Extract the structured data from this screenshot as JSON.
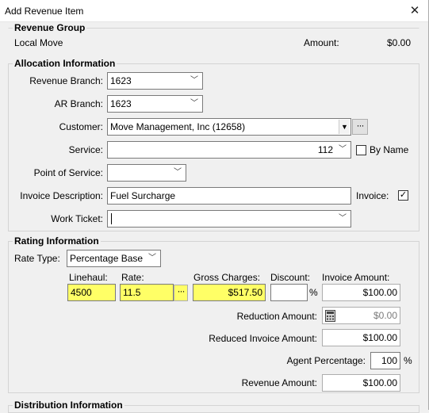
{
  "window": {
    "title": "Add Revenue Item"
  },
  "revenue_group": {
    "title": "Revenue Group",
    "value": "Local Move",
    "amount_label": "Amount:",
    "amount_value": "$0.00"
  },
  "allocation": {
    "title": "Allocation Information",
    "revenue_branch": {
      "label": "Revenue Branch:",
      "value": "1623"
    },
    "ar_branch": {
      "label": "AR Branch:",
      "value": "1623"
    },
    "customer": {
      "label": "Customer:",
      "value": "Move Management, Inc (12658)",
      "more": "···"
    },
    "service": {
      "label": "Service:",
      "value": "112",
      "by_name_label": "By Name",
      "by_name_checked": false
    },
    "point_of_service": {
      "label": "Point of Service:",
      "value": ""
    },
    "invoice_description": {
      "label": "Invoice Description:",
      "value": "Fuel Surcharge"
    },
    "invoice": {
      "label": "Invoice:",
      "checked": true,
      "check_glyph": "✓"
    },
    "work_ticket": {
      "label": "Work Ticket:",
      "value": ""
    }
  },
  "rating": {
    "title": "Rating Information",
    "rate_type": {
      "label": "Rate Type:",
      "value": "Percentage Base"
    },
    "linehaul": {
      "label": "Linehaul:",
      "value": "4500"
    },
    "rate": {
      "label": "Rate:",
      "value": "11.5",
      "more": "···"
    },
    "gross_charges": {
      "label": "Gross Charges:",
      "value": "$517.50"
    },
    "discount": {
      "label": "Discount:",
      "value": "",
      "unit": "%"
    },
    "invoice_amount": {
      "label": "Invoice Amount:",
      "value": "$100.00"
    },
    "reduction_amount": {
      "label": "Reduction Amount:",
      "value": "$0.00"
    },
    "reduced_invoice_amount": {
      "label": "Reduced Invoice Amount:",
      "value": "$100.00"
    },
    "agent_percentage": {
      "label": "Agent Percentage:",
      "value": "100",
      "unit": "%"
    },
    "revenue_amount": {
      "label": "Revenue Amount:",
      "value": "$100.00"
    }
  },
  "distribution": {
    "title": "Distribution Information"
  },
  "icons": {
    "close": "close-icon",
    "chevron": "chevron-down-icon",
    "calculator": "calculator-icon"
  },
  "colors": {
    "highlight": "#ffff66",
    "background": "#f0f0f0"
  }
}
